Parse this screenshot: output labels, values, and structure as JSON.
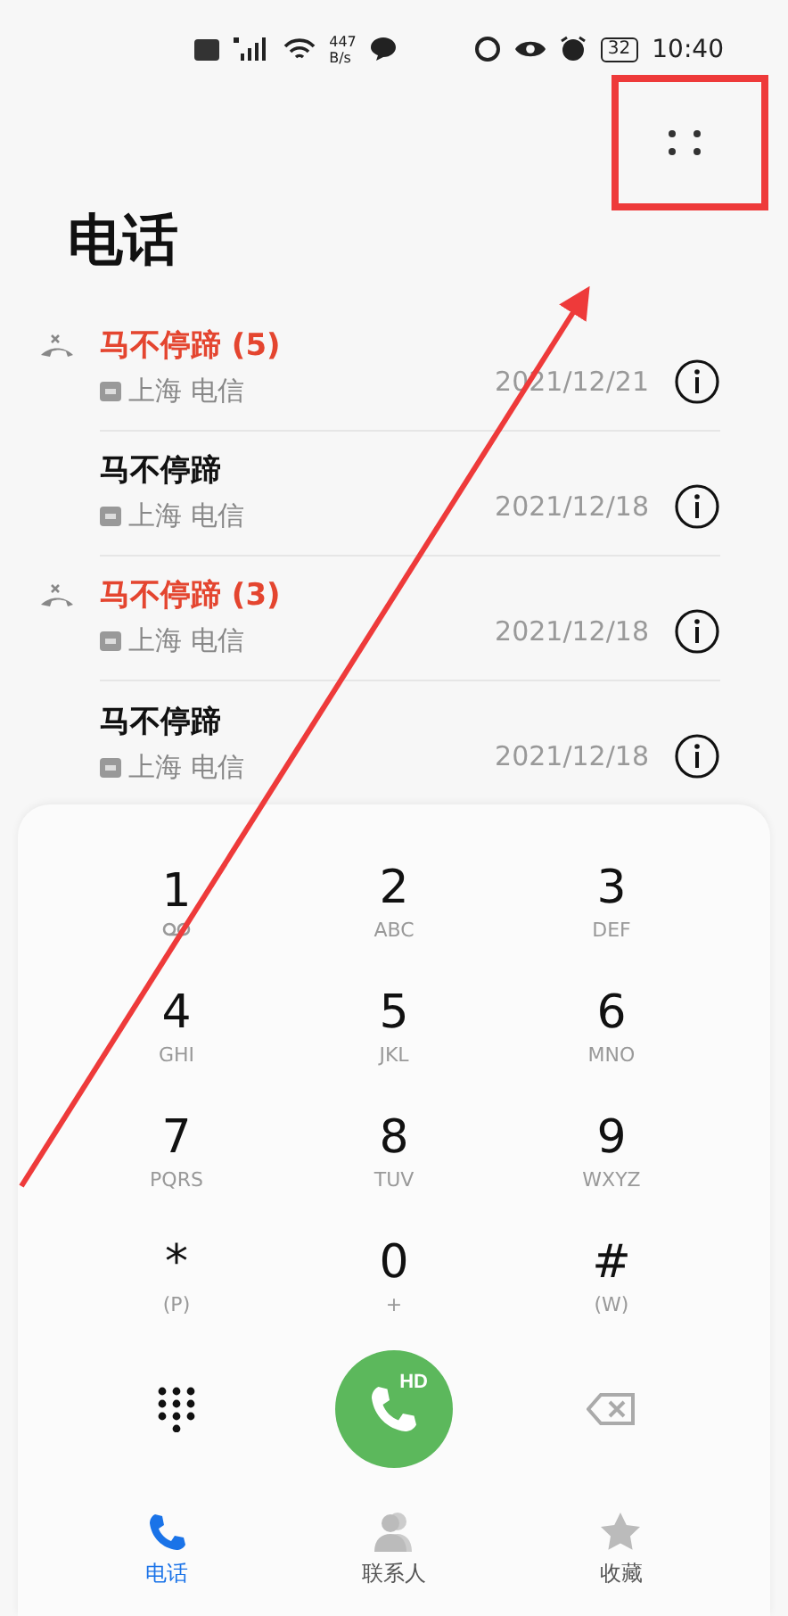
{
  "status_bar": {
    "net_speed": "447",
    "net_unit": "B/s",
    "battery": "32",
    "time": "10:40"
  },
  "title": "电话",
  "calls": [
    {
      "name": "马不停蹄 (5)",
      "missed": true,
      "location": "上海 电信",
      "date": "2021/12/21"
    },
    {
      "name": "马不停蹄",
      "missed": false,
      "location": "上海 电信",
      "date": "2021/12/18"
    },
    {
      "name": "马不停蹄 (3)",
      "missed": true,
      "location": "上海 电信",
      "date": "2021/12/18"
    },
    {
      "name": "马不停蹄",
      "missed": false,
      "location": "上海 电信",
      "date": "2021/12/18"
    }
  ],
  "keypad": [
    {
      "digit": "1",
      "kind": "voicemail"
    },
    {
      "digit": "2",
      "kind": "letters",
      "letters": "ABC"
    },
    {
      "digit": "3",
      "kind": "letters",
      "letters": "DEF"
    },
    {
      "digit": "4",
      "kind": "letters",
      "letters": "GHI"
    },
    {
      "digit": "5",
      "kind": "letters",
      "letters": "JKL"
    },
    {
      "digit": "6",
      "kind": "letters",
      "letters": "MNO"
    },
    {
      "digit": "7",
      "kind": "letters",
      "letters": "PQRS"
    },
    {
      "digit": "8",
      "kind": "letters",
      "letters": "TUV"
    },
    {
      "digit": "9",
      "kind": "letters",
      "letters": "WXYZ"
    },
    {
      "digit": "*",
      "kind": "letters",
      "letters": "(P)"
    },
    {
      "digit": "0",
      "kind": "letters",
      "letters": "+"
    },
    {
      "digit": "#",
      "kind": "letters",
      "letters": "(W)"
    }
  ],
  "call_button": {
    "badge": "HD"
  },
  "tabs": [
    {
      "label": "电话",
      "selected": true,
      "kind": "phone"
    },
    {
      "label": "联系人",
      "selected": false,
      "kind": "contacts"
    },
    {
      "label": "收藏",
      "selected": false,
      "kind": "favorites"
    }
  ]
}
